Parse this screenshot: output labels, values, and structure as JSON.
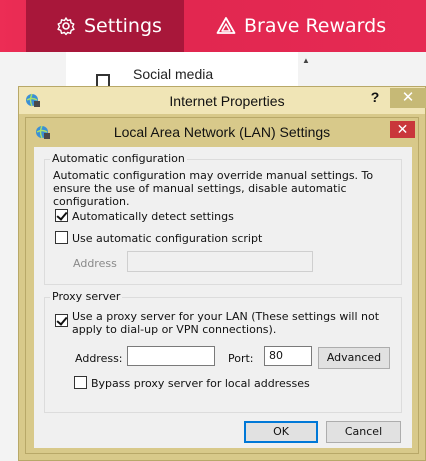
{
  "brave": {
    "tab_settings": "Settings",
    "tab_rewards": "Brave Rewards",
    "social_label": "Social media"
  },
  "internet_properties": {
    "title": "Internet Properties",
    "help_label": "?",
    "close_label": "✕"
  },
  "lan": {
    "title": "Local Area Network (LAN) Settings",
    "close_label": "✕",
    "auto_config": {
      "legend": "Automatic configuration",
      "description": "Automatic configuration may override manual settings.  To ensure the use of manual settings, disable automatic configuration.",
      "auto_detect_label": "Automatically detect settings",
      "auto_detect_checked": true,
      "use_script_label": "Use automatic configuration script",
      "use_script_checked": false,
      "address_label": "Address",
      "address_value": ""
    },
    "proxy": {
      "legend": "Proxy server",
      "use_proxy_label": "Use a proxy server for your LAN (These settings will not apply to dial-up or VPN connections).",
      "use_proxy_checked": true,
      "address_label": "Address:",
      "address_value": "",
      "port_label": "Port:",
      "port_value": "80",
      "advanced_label": "Advanced",
      "bypass_label": "Bypass proxy server for local addresses",
      "bypass_checked": false
    },
    "ok_label": "OK",
    "cancel_label": "Cancel"
  },
  "colors": {
    "brave_accent": "#e62a53",
    "brave_active_tab": "#a8173a",
    "window_frame": "#d8c98a",
    "close_red": "#c9373b"
  }
}
